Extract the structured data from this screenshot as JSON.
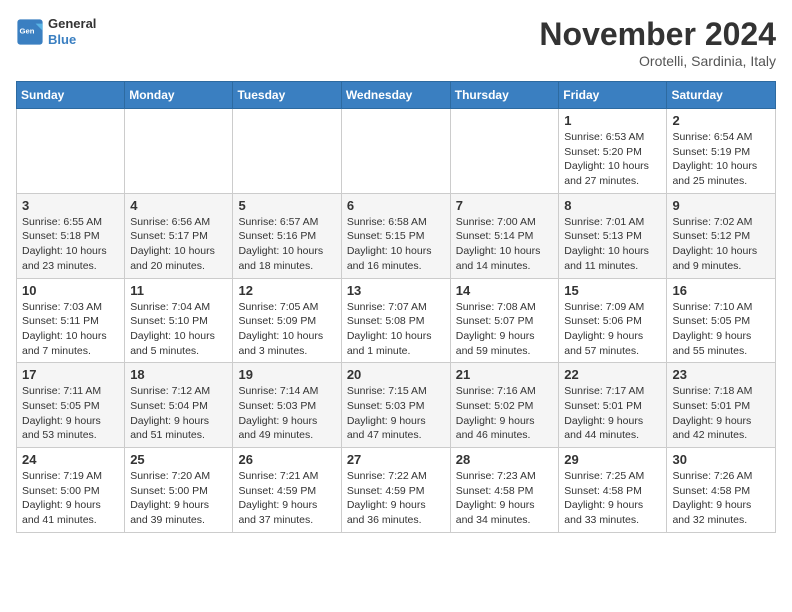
{
  "header": {
    "logo": {
      "general": "General",
      "blue": "Blue"
    },
    "title": "November 2024",
    "subtitle": "Orotelli, Sardinia, Italy"
  },
  "calendar": {
    "weekdays": [
      "Sunday",
      "Monday",
      "Tuesday",
      "Wednesday",
      "Thursday",
      "Friday",
      "Saturday"
    ],
    "weeks": [
      [
        {
          "day": "",
          "info": ""
        },
        {
          "day": "",
          "info": ""
        },
        {
          "day": "",
          "info": ""
        },
        {
          "day": "",
          "info": ""
        },
        {
          "day": "",
          "info": ""
        },
        {
          "day": "1",
          "info": "Sunrise: 6:53 AM\nSunset: 5:20 PM\nDaylight: 10 hours and 27 minutes."
        },
        {
          "day": "2",
          "info": "Sunrise: 6:54 AM\nSunset: 5:19 PM\nDaylight: 10 hours and 25 minutes."
        }
      ],
      [
        {
          "day": "3",
          "info": "Sunrise: 6:55 AM\nSunset: 5:18 PM\nDaylight: 10 hours and 23 minutes."
        },
        {
          "day": "4",
          "info": "Sunrise: 6:56 AM\nSunset: 5:17 PM\nDaylight: 10 hours and 20 minutes."
        },
        {
          "day": "5",
          "info": "Sunrise: 6:57 AM\nSunset: 5:16 PM\nDaylight: 10 hours and 18 minutes."
        },
        {
          "day": "6",
          "info": "Sunrise: 6:58 AM\nSunset: 5:15 PM\nDaylight: 10 hours and 16 minutes."
        },
        {
          "day": "7",
          "info": "Sunrise: 7:00 AM\nSunset: 5:14 PM\nDaylight: 10 hours and 14 minutes."
        },
        {
          "day": "8",
          "info": "Sunrise: 7:01 AM\nSunset: 5:13 PM\nDaylight: 10 hours and 11 minutes."
        },
        {
          "day": "9",
          "info": "Sunrise: 7:02 AM\nSunset: 5:12 PM\nDaylight: 10 hours and 9 minutes."
        }
      ],
      [
        {
          "day": "10",
          "info": "Sunrise: 7:03 AM\nSunset: 5:11 PM\nDaylight: 10 hours and 7 minutes."
        },
        {
          "day": "11",
          "info": "Sunrise: 7:04 AM\nSunset: 5:10 PM\nDaylight: 10 hours and 5 minutes."
        },
        {
          "day": "12",
          "info": "Sunrise: 7:05 AM\nSunset: 5:09 PM\nDaylight: 10 hours and 3 minutes."
        },
        {
          "day": "13",
          "info": "Sunrise: 7:07 AM\nSunset: 5:08 PM\nDaylight: 10 hours and 1 minute."
        },
        {
          "day": "14",
          "info": "Sunrise: 7:08 AM\nSunset: 5:07 PM\nDaylight: 9 hours and 59 minutes."
        },
        {
          "day": "15",
          "info": "Sunrise: 7:09 AM\nSunset: 5:06 PM\nDaylight: 9 hours and 57 minutes."
        },
        {
          "day": "16",
          "info": "Sunrise: 7:10 AM\nSunset: 5:05 PM\nDaylight: 9 hours and 55 minutes."
        }
      ],
      [
        {
          "day": "17",
          "info": "Sunrise: 7:11 AM\nSunset: 5:05 PM\nDaylight: 9 hours and 53 minutes."
        },
        {
          "day": "18",
          "info": "Sunrise: 7:12 AM\nSunset: 5:04 PM\nDaylight: 9 hours and 51 minutes."
        },
        {
          "day": "19",
          "info": "Sunrise: 7:14 AM\nSunset: 5:03 PM\nDaylight: 9 hours and 49 minutes."
        },
        {
          "day": "20",
          "info": "Sunrise: 7:15 AM\nSunset: 5:03 PM\nDaylight: 9 hours and 47 minutes."
        },
        {
          "day": "21",
          "info": "Sunrise: 7:16 AM\nSunset: 5:02 PM\nDaylight: 9 hours and 46 minutes."
        },
        {
          "day": "22",
          "info": "Sunrise: 7:17 AM\nSunset: 5:01 PM\nDaylight: 9 hours and 44 minutes."
        },
        {
          "day": "23",
          "info": "Sunrise: 7:18 AM\nSunset: 5:01 PM\nDaylight: 9 hours and 42 minutes."
        }
      ],
      [
        {
          "day": "24",
          "info": "Sunrise: 7:19 AM\nSunset: 5:00 PM\nDaylight: 9 hours and 41 minutes."
        },
        {
          "day": "25",
          "info": "Sunrise: 7:20 AM\nSunset: 5:00 PM\nDaylight: 9 hours and 39 minutes."
        },
        {
          "day": "26",
          "info": "Sunrise: 7:21 AM\nSunset: 4:59 PM\nDaylight: 9 hours and 37 minutes."
        },
        {
          "day": "27",
          "info": "Sunrise: 7:22 AM\nSunset: 4:59 PM\nDaylight: 9 hours and 36 minutes."
        },
        {
          "day": "28",
          "info": "Sunrise: 7:23 AM\nSunset: 4:58 PM\nDaylight: 9 hours and 34 minutes."
        },
        {
          "day": "29",
          "info": "Sunrise: 7:25 AM\nSunset: 4:58 PM\nDaylight: 9 hours and 33 minutes."
        },
        {
          "day": "30",
          "info": "Sunrise: 7:26 AM\nSunset: 4:58 PM\nDaylight: 9 hours and 32 minutes."
        }
      ]
    ]
  }
}
